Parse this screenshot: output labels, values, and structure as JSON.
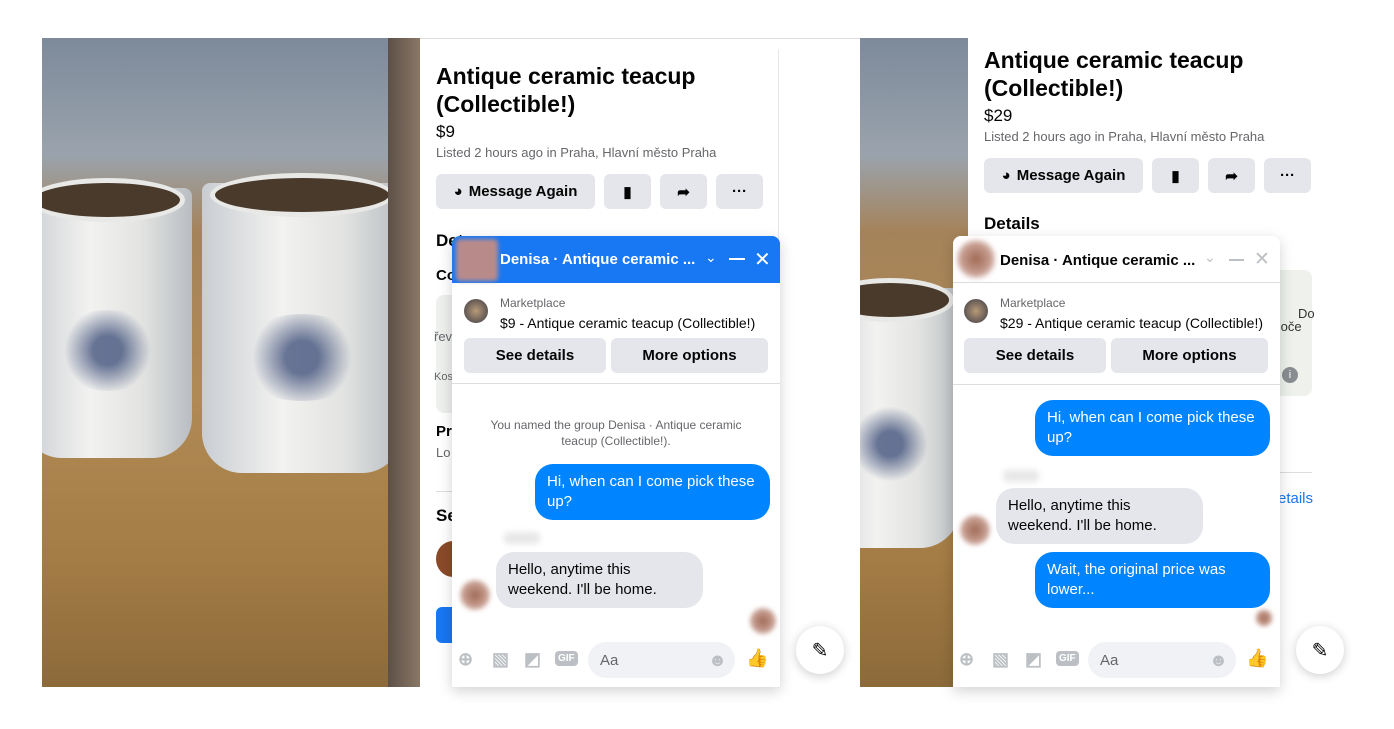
{
  "colors": {
    "accent": "#0084ff",
    "header_blue": "#1877f2",
    "button_gray": "#e4e6eb"
  },
  "left": {
    "listing": {
      "title": "Antique ceramic teacup (Collectible!)",
      "price": "$9",
      "listed": "Listed 2 hours ago in Praha, Hlavní město Praha",
      "message_again": "Message Again",
      "details_fragment": "Det",
      "frag_co": "Co",
      "frag_pr": "Pr",
      "frag_lo": "Lo",
      "frag_se": "Se",
      "map_frag1": "řev",
      "map_frag2": "Kos"
    },
    "chat": {
      "title": "Denisa · Antique ceramic ...",
      "marketplace_label": "Marketplace",
      "item_line": "$9 - Antique ceramic teacup (Collectible!)",
      "see_details": "See details",
      "more_options": "More options",
      "system_note": "You named the group Denisa · Antique ceramic teacup (Collectible!).",
      "messages": [
        {
          "from": "me",
          "text": "Hi, when can I come pick these up?"
        },
        {
          "from": "seller",
          "text": "Hello, anytime this weekend. I'll be home."
        }
      ],
      "input_placeholder": "Aa"
    }
  },
  "right": {
    "listing": {
      "title": "Antique ceramic teacup (Collectible!)",
      "price": "$29",
      "listed": "Listed 2 hours ago in Praha, Hlavní město Praha",
      "message_again": "Message Again",
      "details": "Details",
      "details_link_fragment": "etails",
      "map_frag1": "Do",
      "map_frag2": "Poče"
    },
    "chat": {
      "title": "Denisa · Antique ceramic ...",
      "marketplace_label": "Marketplace",
      "item_line": "$29 - Antique ceramic teacup (Collectible!)",
      "see_details": "See details",
      "more_options": "More options",
      "messages": [
        {
          "from": "me",
          "text": "Hi, when can I come pick these up?"
        },
        {
          "from": "seller",
          "text": "Hello, anytime this weekend. I'll be home."
        },
        {
          "from": "me",
          "text": "Wait, the original price was lower..."
        }
      ],
      "input_placeholder": "Aa"
    }
  },
  "icons": {
    "messenger": "messenger-icon",
    "save": "bookmark-icon",
    "share": "share-icon",
    "more": "ellipsis-icon",
    "compose": "compose-icon"
  }
}
